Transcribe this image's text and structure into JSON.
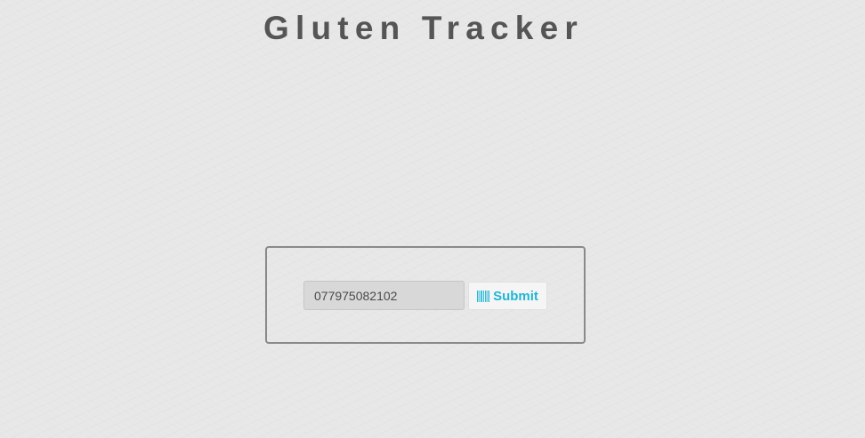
{
  "header": {
    "title": "Gluten Tracker"
  },
  "form": {
    "barcode_value": "077975082102",
    "submit_label": "Submit",
    "submit_icon": "barcode-icon"
  },
  "colors": {
    "accent": "#1fb6d6",
    "title": "#555555",
    "background": "#e7e7e7",
    "panel_border": "#8a8a8a"
  }
}
